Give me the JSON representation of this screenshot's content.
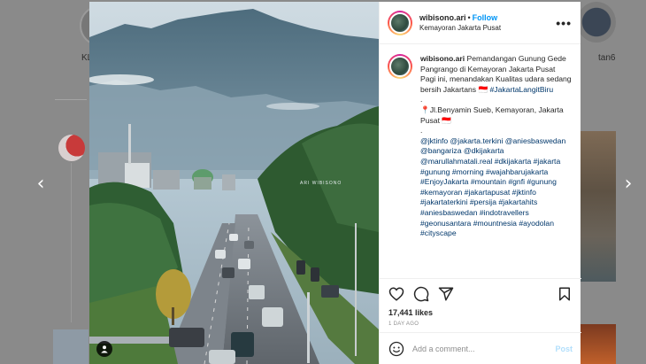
{
  "background": {
    "story_label_left": "KL",
    "story_label_right": "tan6"
  },
  "nav": {
    "prev_icon": "chevron-left-icon",
    "next_icon": "chevron-right-icon",
    "prev_glyph": "‹",
    "next_glyph": "›"
  },
  "photo": {
    "watermark": "ARI WIBISONO"
  },
  "post": {
    "username": "wibisono.ari",
    "follow_label": "Follow",
    "location": "Kemayoran Jakarta Pusat",
    "more_icon": "more-options-icon",
    "more_glyph": "•••",
    "caption_username": "wibisono.ari",
    "caption_text": "Pemandangan Gunung Gede Pangrango di Kemayoran Jakarta Pusat Pagi ini, menandakan Kualitas udara sedang bersih Jakartans 🇮🇩",
    "caption_hashtag_1": "#JakartaLangitBiru",
    "caption_dot_1": ".",
    "caption_location": "📍Jl.Benyamin Sueb, Kemayoran, Jakarta Pusat 🇮🇩",
    "caption_dot_2": ".",
    "tags": "@jktinfo @jakarta.terkini @aniesbaswedan @bangariza @dkijakarta @marullahmatali.real #dkijakarta #jakarta #gunung #morning #wajahbarujakarta #EnjoyJakarta #mountain #gnfi #gunung #kemayoran #jakartapusat #jktinfo #jakartaterkini #persija #jakartahits #aniesbaswedan #indotravellers #geonusantara #mountnesia #ayodolan #cityscape",
    "likes": "17,441 likes",
    "time": "1 DAY AGO",
    "comment_placeholder": "Add a comment...",
    "post_label": "Post"
  },
  "colors": {
    "accent": "#0095f6",
    "hashtag": "#00376b",
    "post_disabled": "#b2dffc",
    "muted": "#8e8e8e"
  }
}
